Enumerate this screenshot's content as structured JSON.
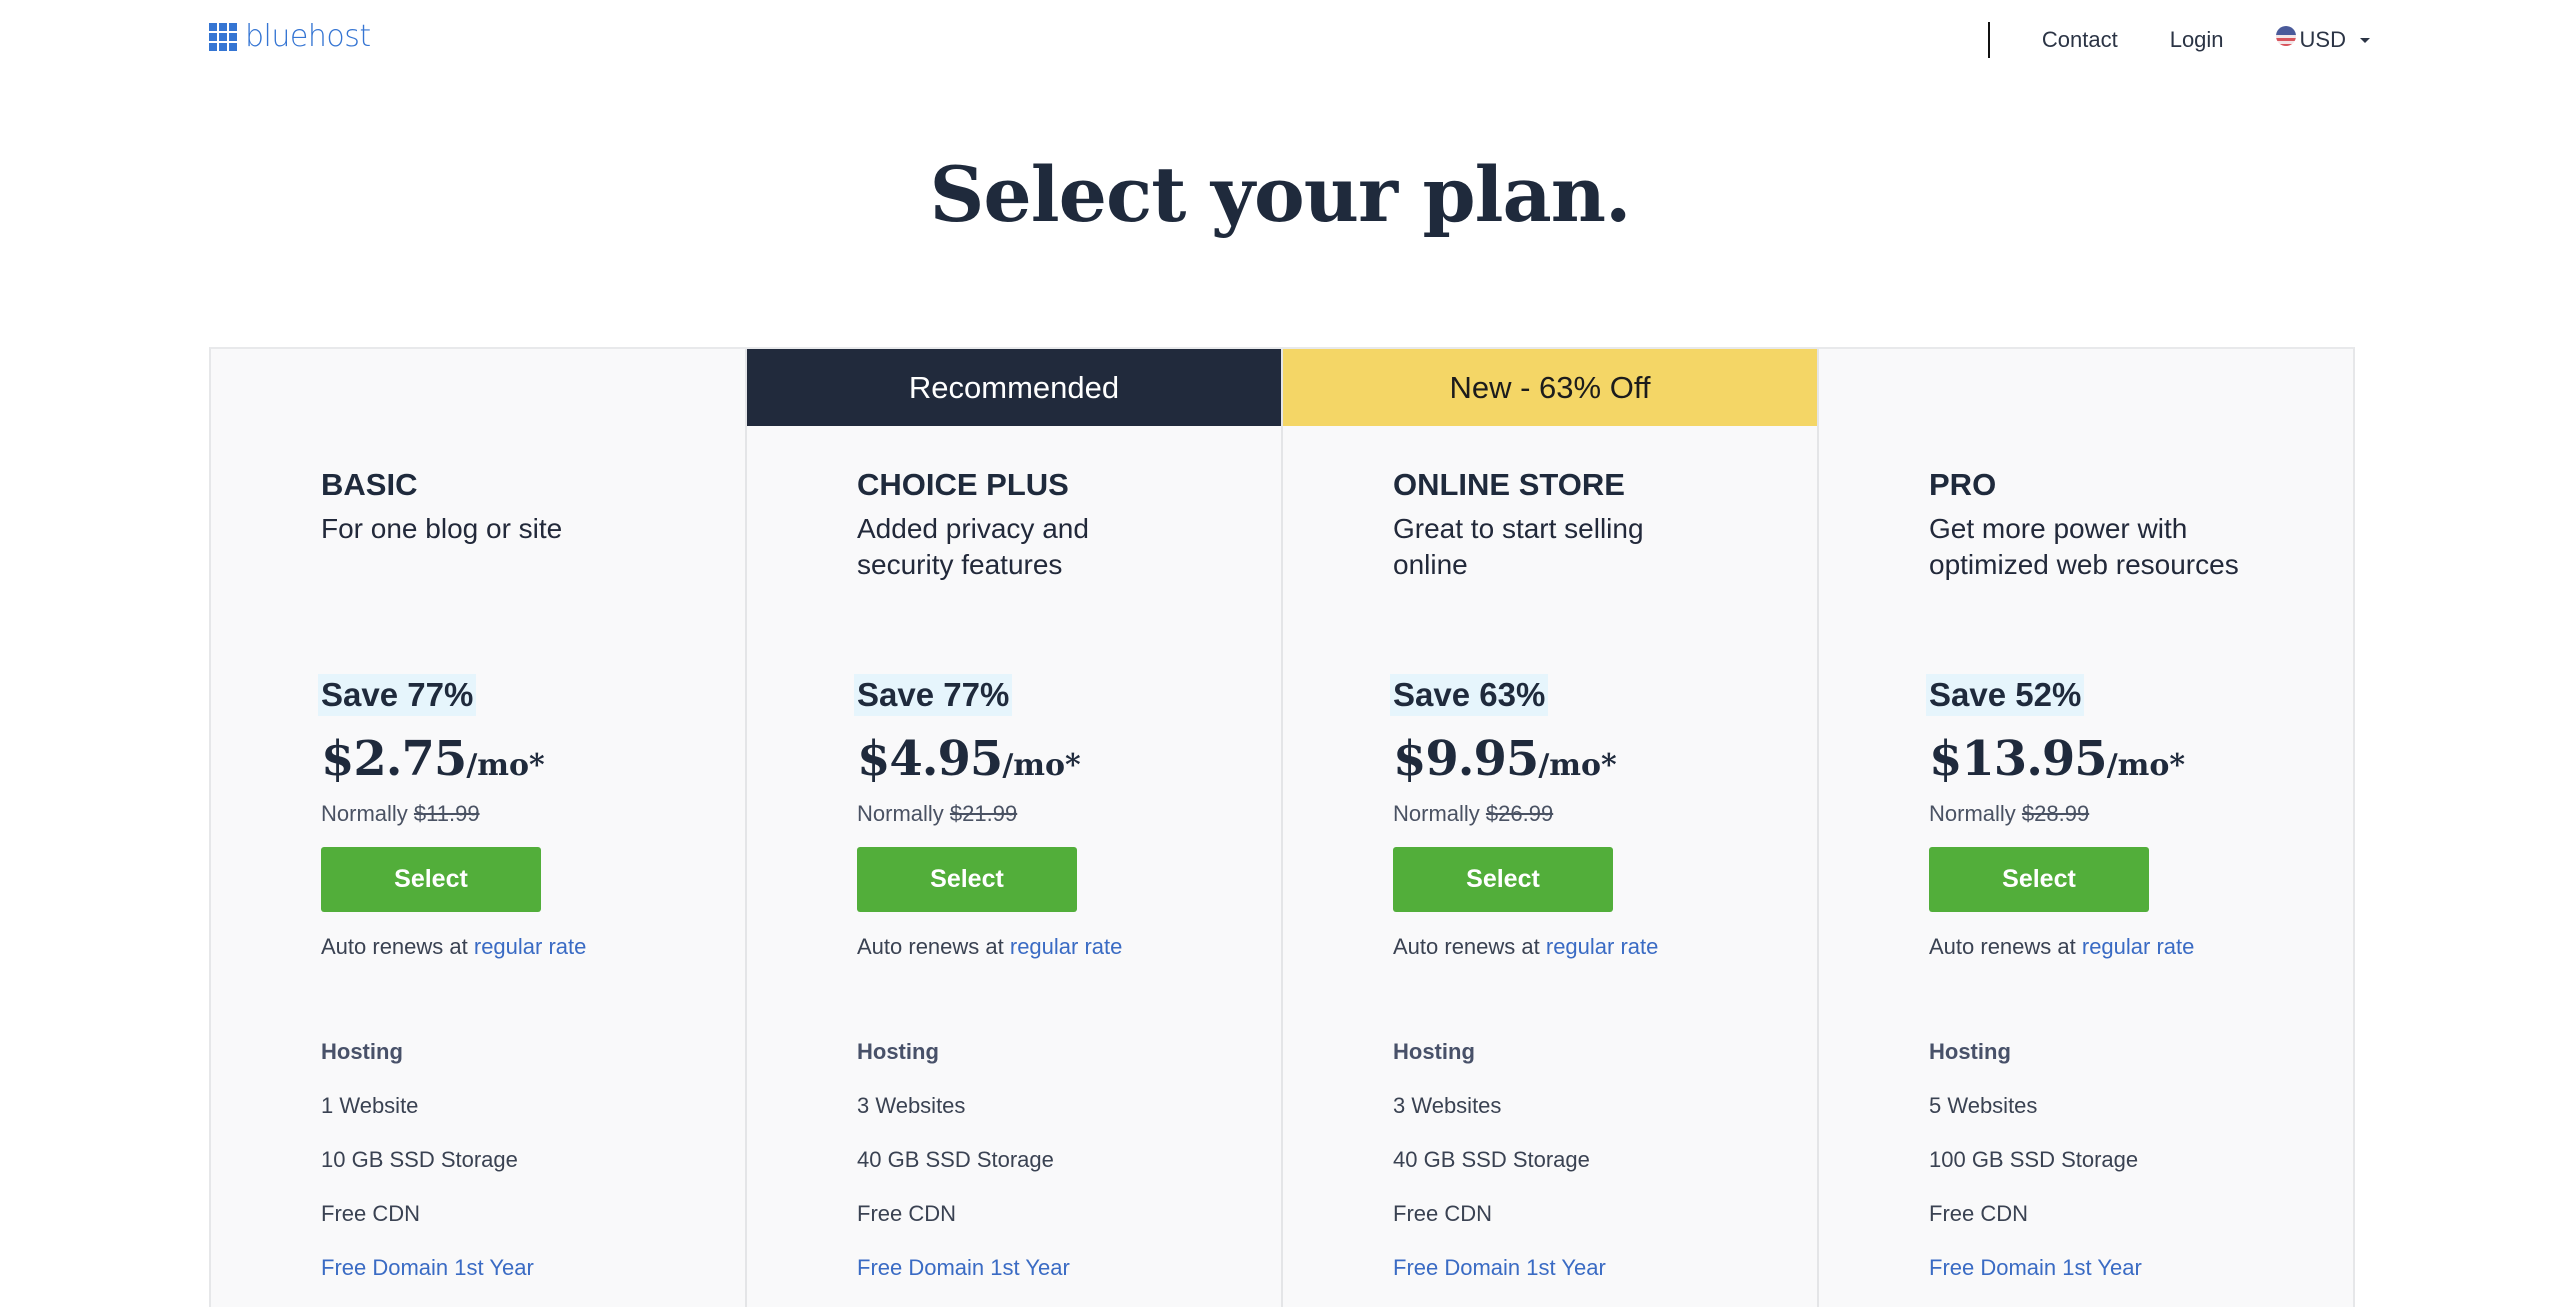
{
  "header": {
    "logo_text": "bluehost",
    "nav": {
      "contact": "Contact",
      "login": "Login",
      "currency": "USD"
    }
  },
  "page": {
    "title": "Select your plan."
  },
  "colors": {
    "brand_blue": "#3575d3",
    "dark_navy": "#212a3c",
    "ribbon_yellow": "#f4d666",
    "select_green": "#52ae3a",
    "link_blue": "#3a6bc4",
    "save_highlight": "#e6f5fc"
  },
  "plans": [
    {
      "ribbon": "",
      "name": "BASIC",
      "description": "For one blog or site",
      "save": "Save 77%",
      "price": "$2.75",
      "price_unit": "/mo*",
      "normally_label": "Normally",
      "normal_price": "$11.99",
      "select_label": "Select",
      "renew_text": "Auto renews at",
      "renew_link": "regular rate",
      "features_heading": "Hosting",
      "features": [
        "1 Website",
        "10 GB SSD Storage",
        "Free CDN"
      ],
      "feature_link": "Free Domain 1st Year"
    },
    {
      "ribbon": "Recommended",
      "name": "CHOICE PLUS",
      "description": "Added privacy and security features",
      "save": "Save 77%",
      "price": "$4.95",
      "price_unit": "/mo*",
      "normally_label": "Normally",
      "normal_price": "$21.99",
      "select_label": "Select",
      "renew_text": "Auto renews at",
      "renew_link": "regular rate",
      "features_heading": "Hosting",
      "features": [
        "3 Websites",
        "40 GB SSD Storage",
        "Free CDN"
      ],
      "feature_link": "Free Domain 1st Year"
    },
    {
      "ribbon": "New - 63% Off",
      "name": "ONLINE STORE",
      "description": "Great to start selling online",
      "save": "Save 63%",
      "price": "$9.95",
      "price_unit": "/mo*",
      "normally_label": "Normally",
      "normal_price": "$26.99",
      "select_label": "Select",
      "renew_text": "Auto renews at",
      "renew_link": "regular rate",
      "features_heading": "Hosting",
      "features": [
        "3 Websites",
        "40 GB SSD Storage",
        "Free CDN"
      ],
      "feature_link": "Free Domain 1st Year"
    },
    {
      "ribbon": "",
      "name": "PRO",
      "description": "Get more power with optimized web resources",
      "save": "Save 52%",
      "price": "$13.95",
      "price_unit": "/mo*",
      "normally_label": "Normally",
      "normal_price": "$28.99",
      "select_label": "Select",
      "renew_text": "Auto renews at",
      "renew_link": "regular rate",
      "features_heading": "Hosting",
      "features": [
        "5 Websites",
        "100 GB SSD Storage",
        "Free CDN"
      ],
      "feature_link": "Free Domain 1st Year"
    }
  ]
}
